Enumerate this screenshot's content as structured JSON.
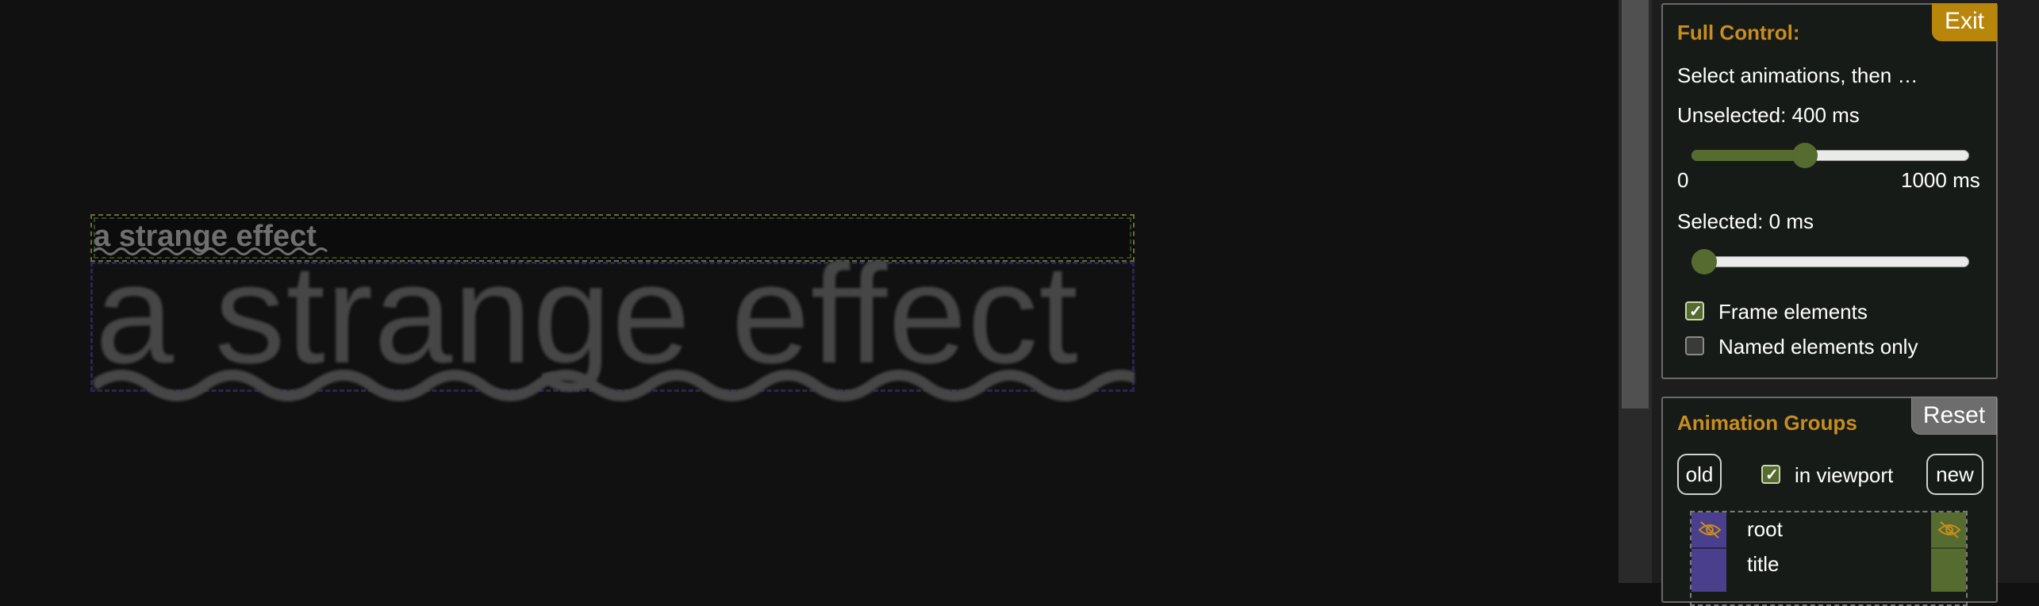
{
  "stage": {
    "small_title": "a strange effect",
    "big_title": "a strange effect"
  },
  "panel": {
    "exit_label": "Exit",
    "full_control": {
      "title": "Full Control:",
      "instruction": "Select animations, then …",
      "unselected_label": "Unselected: 400 ms",
      "unselected_value_ms": 400,
      "slider_min": "0",
      "slider_max": "1000 ms",
      "slider_range_ms": [
        0,
        1000
      ],
      "selected_label": "Selected: 0 ms",
      "selected_value_ms": 0,
      "frame_elements_label": "Frame elements",
      "frame_elements_checked": true,
      "named_only_label": "Named elements only",
      "named_only_checked": false
    },
    "animation_groups": {
      "title": "Animation Groups",
      "reset_label": "Reset",
      "old_label": "old",
      "new_label": "new",
      "in_viewport_label": "in viewport",
      "in_viewport_checked": true,
      "items": [
        {
          "label": "root"
        },
        {
          "label": "title"
        }
      ]
    }
  },
  "colors": {
    "accent_gold": "#c88d1f",
    "old_purple": "#4a3f8c",
    "new_olive": "#556b2f"
  },
  "icons": {
    "eye_slash": "eye-slash-icon",
    "checkmark": "checkmark-icon"
  }
}
